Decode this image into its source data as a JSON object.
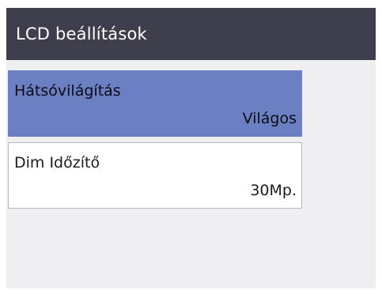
{
  "header": {
    "title": "LCD beállítások"
  },
  "menu": {
    "items": [
      {
        "label": "Hátsóvilágítás",
        "value": "Világos"
      },
      {
        "label": "Dim Időzítő",
        "value": "30Mp."
      }
    ]
  },
  "colors": {
    "title_bar": "#3f3e4c",
    "selected_item": "#6a80c2",
    "screen_background": "#efeff2"
  }
}
